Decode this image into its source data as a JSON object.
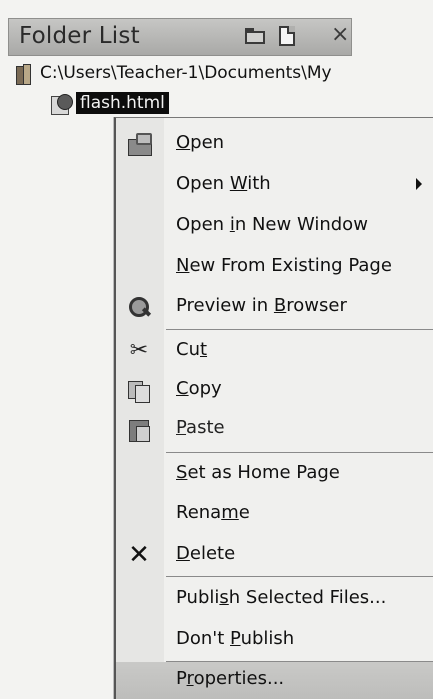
{
  "panel": {
    "title": "Folder List"
  },
  "tree": {
    "root_path": "C:\\Users\\Teacher-1\\Documents\\My",
    "selected_file": "flash.html"
  },
  "menu": {
    "items": [
      {
        "pre": "",
        "ul": "O",
        "post": "pen"
      },
      {
        "pre": "Open ",
        "ul": "W",
        "post": "ith"
      },
      {
        "pre": "Open ",
        "ul": "i",
        "post": "n New Window"
      },
      {
        "pre": "",
        "ul": "N",
        "post": "ew From Existing Page"
      },
      {
        "pre": "Preview in ",
        "ul": "B",
        "post": "rowser"
      },
      {
        "pre": "Cu",
        "ul": "t",
        "post": ""
      },
      {
        "pre": "",
        "ul": "C",
        "post": "opy"
      },
      {
        "pre": "",
        "ul": "P",
        "post": "aste"
      },
      {
        "pre": "",
        "ul": "S",
        "post": "et as Home Page"
      },
      {
        "pre": "Rena",
        "ul": "m",
        "post": "e"
      },
      {
        "pre": "",
        "ul": "D",
        "post": "elete"
      },
      {
        "pre": "Publi",
        "ul": "s",
        "post": "h Selected Files..."
      },
      {
        "pre": "Don't ",
        "ul": "P",
        "post": "ublish"
      },
      {
        "pre": "P",
        "ul": "r",
        "post": "operties..."
      }
    ]
  }
}
